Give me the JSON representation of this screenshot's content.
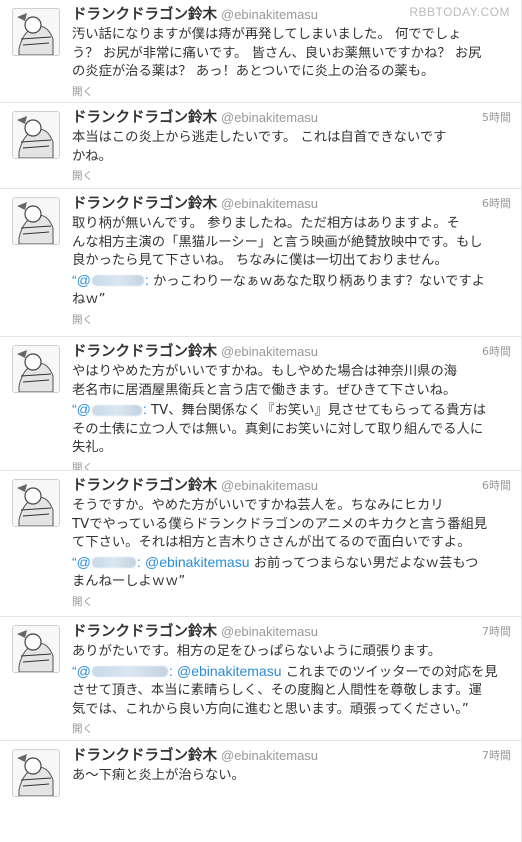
{
  "watermark": "RBBTODAY.COM",
  "tweets": [
    {
      "name": "ドランクドラゴン鈴木",
      "handle": "@ebinakitemasu",
      "time": "",
      "lines": [
        "汚い話になりますが僕は痔が再発してしまいました。 何ででしょ",
        "う？ お尻が非常に痛いです。 皆さん、良いお薬無いですかね？ お尻",
        "の炎症が治る薬は？ あっ！あとついでに炎上の治るの薬も。"
      ],
      "open": "開く"
    },
    {
      "name": "ドランクドラゴン鈴木",
      "handle": "@ebinakitemasu",
      "time": "5時間",
      "lines": [
        "本当はこの炎上から逃走したいです。 これは自首できないです",
        "かね。"
      ],
      "open": "開く"
    },
    {
      "name": "ドランクドラゴン鈴木",
      "handle": "@ebinakitemasu",
      "time": "6時間",
      "lines": [
        "取り柄が無いんです。 参りましたね。ただ相方はありますよ。そ",
        "んな相方主演の「黒猫ルーシー」と言う映画が絶賛放映中です。もし",
        "良かったら見て下さいね。 ちなみに僕は一切出ておりません。"
      ],
      "mention_prefix": "“@",
      "mention_tail": "かっこわりーなぁｗあなた取り柄あります？ないですよ",
      "extra_line": "ねｗ”",
      "open": "開く"
    },
    {
      "name": "ドランクドラゴン鈴木",
      "handle": "@ebinakitemasu",
      "time": "6時間",
      "lines": [
        "やはりやめた方がいいですかね。もしやめた場合は神奈川県の海",
        "老名市に居酒屋黒衛兵と言う店で働きます。ぜひきて下さいね。"
      ],
      "mention_prefix": "“@",
      "mention_tail": "TV、舞台関係なく『お笑い』見させてもらってる貴方は",
      "extra_lines": [
        "その土俵に立つ人では無い。真剣にお笑いに対して取り組んでる人に",
        "失礼。"
      ],
      "open": "開く"
    },
    {
      "name": "ドランクドラゴン鈴木",
      "handle": "@ebinakitemasu",
      "time": "6時間",
      "lines": [
        "そうですか。やめた方がいいですかね芸人を。ちなみにヒカリ",
        "TVでやっている僕らドランクドラゴンのアニメのキカクと言う番組見",
        "て下さい。それは相方と吉木りささんが出てるので面白いですよ。"
      ],
      "mention_prefix": "“@",
      "mention_handle": "@ebinakitemasu",
      "mention_tail": "お前ってつまらない男だよなｗ芸もつ",
      "extra_line": "まんねーしよｗｗ”",
      "open": "開く"
    },
    {
      "name": "ドランクドラゴン鈴木",
      "handle": "@ebinakitemasu",
      "time": "7時間",
      "lines": [
        "ありがたいです。相方の足をひっぱらないように頑張ります。"
      ],
      "mention_prefix": "“@",
      "mention_handle": "@ebinakitemasu",
      "mention_tail": "これまでのツイッターでの対応を見",
      "extra_lines": [
        "させて頂き、本当に素晴らしく、その度胸と人間性を尊敬します。運",
        "気では、これから良い方向に進むと思います。頑張ってください。”"
      ],
      "open": "開く"
    },
    {
      "name": "ドランクドラゴン鈴木",
      "handle": "@ebinakitemasu",
      "time": "7時間",
      "lines": [
        "あ～下痢と炎上が治らない。"
      ],
      "open": ""
    }
  ]
}
